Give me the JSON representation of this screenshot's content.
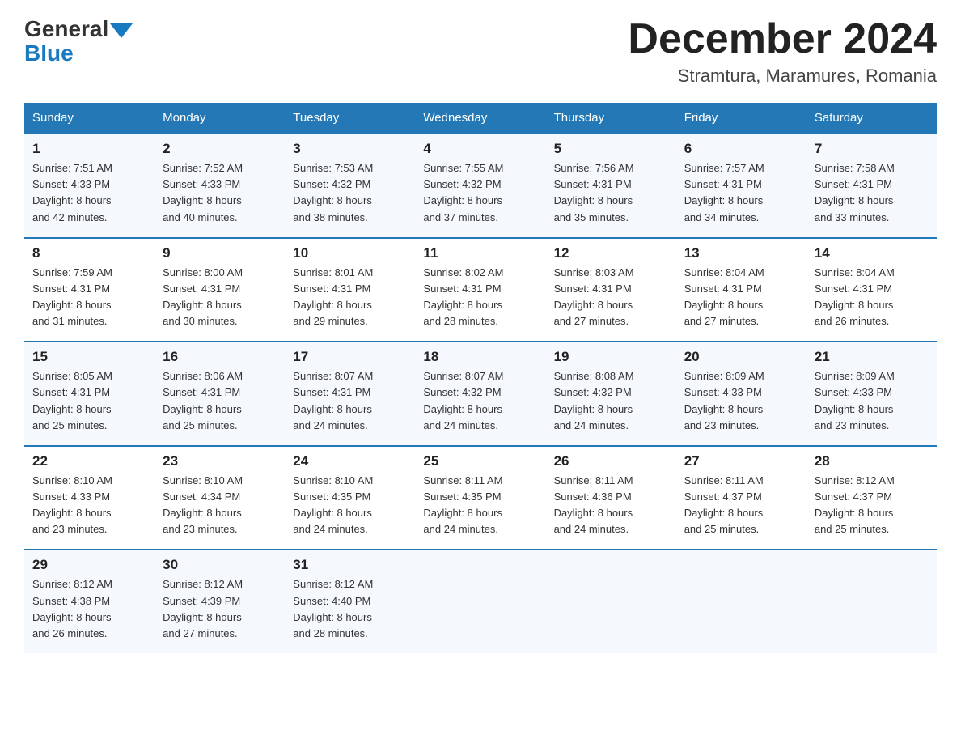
{
  "logo": {
    "general": "General",
    "blue": "Blue"
  },
  "title": "December 2024",
  "subtitle": "Stramtura, Maramures, Romania",
  "headers": [
    "Sunday",
    "Monday",
    "Tuesday",
    "Wednesday",
    "Thursday",
    "Friday",
    "Saturday"
  ],
  "weeks": [
    [
      {
        "day": "1",
        "sunrise": "7:51 AM",
        "sunset": "4:33 PM",
        "daylight": "8 hours and 42 minutes."
      },
      {
        "day": "2",
        "sunrise": "7:52 AM",
        "sunset": "4:33 PM",
        "daylight": "8 hours and 40 minutes."
      },
      {
        "day": "3",
        "sunrise": "7:53 AM",
        "sunset": "4:32 PM",
        "daylight": "8 hours and 38 minutes."
      },
      {
        "day": "4",
        "sunrise": "7:55 AM",
        "sunset": "4:32 PM",
        "daylight": "8 hours and 37 minutes."
      },
      {
        "day": "5",
        "sunrise": "7:56 AM",
        "sunset": "4:31 PM",
        "daylight": "8 hours and 35 minutes."
      },
      {
        "day": "6",
        "sunrise": "7:57 AM",
        "sunset": "4:31 PM",
        "daylight": "8 hours and 34 minutes."
      },
      {
        "day": "7",
        "sunrise": "7:58 AM",
        "sunset": "4:31 PM",
        "daylight": "8 hours and 33 minutes."
      }
    ],
    [
      {
        "day": "8",
        "sunrise": "7:59 AM",
        "sunset": "4:31 PM",
        "daylight": "8 hours and 31 minutes."
      },
      {
        "day": "9",
        "sunrise": "8:00 AM",
        "sunset": "4:31 PM",
        "daylight": "8 hours and 30 minutes."
      },
      {
        "day": "10",
        "sunrise": "8:01 AM",
        "sunset": "4:31 PM",
        "daylight": "8 hours and 29 minutes."
      },
      {
        "day": "11",
        "sunrise": "8:02 AM",
        "sunset": "4:31 PM",
        "daylight": "8 hours and 28 minutes."
      },
      {
        "day": "12",
        "sunrise": "8:03 AM",
        "sunset": "4:31 PM",
        "daylight": "8 hours and 27 minutes."
      },
      {
        "day": "13",
        "sunrise": "8:04 AM",
        "sunset": "4:31 PM",
        "daylight": "8 hours and 27 minutes."
      },
      {
        "day": "14",
        "sunrise": "8:04 AM",
        "sunset": "4:31 PM",
        "daylight": "8 hours and 26 minutes."
      }
    ],
    [
      {
        "day": "15",
        "sunrise": "8:05 AM",
        "sunset": "4:31 PM",
        "daylight": "8 hours and 25 minutes."
      },
      {
        "day": "16",
        "sunrise": "8:06 AM",
        "sunset": "4:31 PM",
        "daylight": "8 hours and 25 minutes."
      },
      {
        "day": "17",
        "sunrise": "8:07 AM",
        "sunset": "4:31 PM",
        "daylight": "8 hours and 24 minutes."
      },
      {
        "day": "18",
        "sunrise": "8:07 AM",
        "sunset": "4:32 PM",
        "daylight": "8 hours and 24 minutes."
      },
      {
        "day": "19",
        "sunrise": "8:08 AM",
        "sunset": "4:32 PM",
        "daylight": "8 hours and 24 minutes."
      },
      {
        "day": "20",
        "sunrise": "8:09 AM",
        "sunset": "4:33 PM",
        "daylight": "8 hours and 23 minutes."
      },
      {
        "day": "21",
        "sunrise": "8:09 AM",
        "sunset": "4:33 PM",
        "daylight": "8 hours and 23 minutes."
      }
    ],
    [
      {
        "day": "22",
        "sunrise": "8:10 AM",
        "sunset": "4:33 PM",
        "daylight": "8 hours and 23 minutes."
      },
      {
        "day": "23",
        "sunrise": "8:10 AM",
        "sunset": "4:34 PM",
        "daylight": "8 hours and 23 minutes."
      },
      {
        "day": "24",
        "sunrise": "8:10 AM",
        "sunset": "4:35 PM",
        "daylight": "8 hours and 24 minutes."
      },
      {
        "day": "25",
        "sunrise": "8:11 AM",
        "sunset": "4:35 PM",
        "daylight": "8 hours and 24 minutes."
      },
      {
        "day": "26",
        "sunrise": "8:11 AM",
        "sunset": "4:36 PM",
        "daylight": "8 hours and 24 minutes."
      },
      {
        "day": "27",
        "sunrise": "8:11 AM",
        "sunset": "4:37 PM",
        "daylight": "8 hours and 25 minutes."
      },
      {
        "day": "28",
        "sunrise": "8:12 AM",
        "sunset": "4:37 PM",
        "daylight": "8 hours and 25 minutes."
      }
    ],
    [
      {
        "day": "29",
        "sunrise": "8:12 AM",
        "sunset": "4:38 PM",
        "daylight": "8 hours and 26 minutes."
      },
      {
        "day": "30",
        "sunrise": "8:12 AM",
        "sunset": "4:39 PM",
        "daylight": "8 hours and 27 minutes."
      },
      {
        "day": "31",
        "sunrise": "8:12 AM",
        "sunset": "4:40 PM",
        "daylight": "8 hours and 28 minutes."
      },
      null,
      null,
      null,
      null
    ]
  ],
  "sunrise_label": "Sunrise:",
  "sunset_label": "Sunset:",
  "daylight_label": "Daylight:"
}
